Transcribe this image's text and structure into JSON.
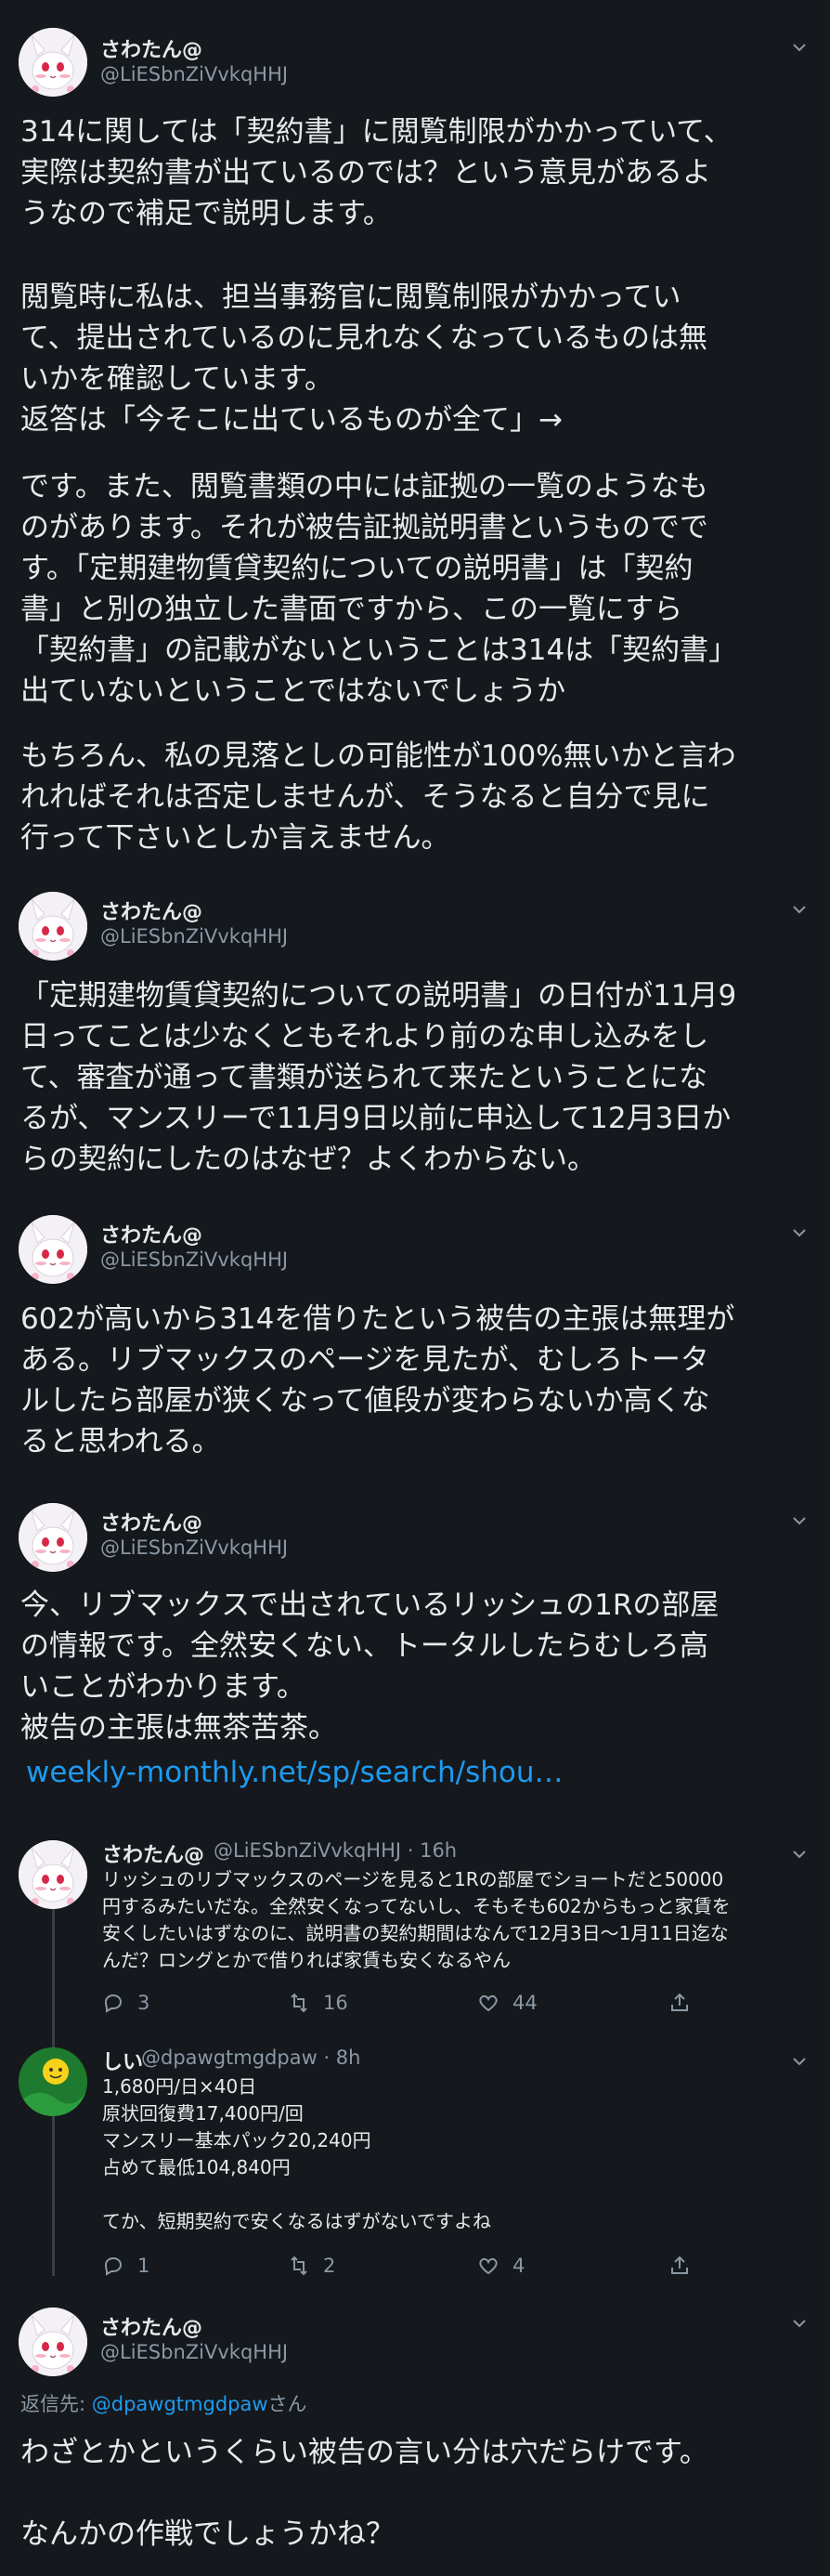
{
  "user": {
    "name": "さわたん@",
    "handle": "@LiESbnZiVvkqHHJ"
  },
  "tweets": [
    {
      "p1": "314に関しては「契約書」に閲覧制限がかかっていて、\n実際は契約書が出ているのでは？という意見があるよ\nうなので補足で説明します。",
      "p2": "閲覧時に私は、担当事務官に閲覧制限がかかってい\nて、提出されているのに見れなくなっているものは無\nいかを確認しています。\n返答は「今そこに出ているものが全て」→",
      "p3": "です。また、閲覧書類の中には証拠の一覧のようなも\nのがあります。それが被告証拠説明書というものでで\nす。「定期建物賃貸契約についての説明書」は「契約\n書」と別の独立した書面ですから、この一覧にすら\n「契約書」の記載がないということは314は「契約書」\n出ていないということではないでしょうか",
      "p4": "もちろん、私の見落としの可能性が100%無いかと言わ\nれればそれは否定しませんが、そうなると自分で見に\n行って下さいとしか言えません。"
    },
    {
      "text": "「定期建物賃貸契約についての説明書」の日付が11月9\n日ってことは少なくともそれより前のな申し込みをし\nて、審査が通って書類が送られて来たということにな\nるが、マンスリーで11月9日以前に申込して12月3日か\nらの契約にしたのはなぜ？よくわからない。"
    },
    {
      "text": "602が高いから314を借りたという被告の主張は無理が\nある。リブマックスのページを見たが、むしろトータ\nルしたら部屋が狭くなって値段が変わらないか高くな\nると思われる。"
    },
    {
      "text": "今、リブマックスで出されているリッシュの1Rの部屋\nの情報です。全然安くない、トータルしたらむしろ高\nいことがわかります。\n被告の主張は無茶苦茶。",
      "link": "weekly-monthly.net/sp/search/shou…"
    }
  ],
  "replies": [
    {
      "name": "さわたん@",
      "meta": "@LiESbnZiVvkqHHJ · 16h",
      "text": "リッシュのリブマックスのページを見ると1Rの部屋でショートだと50000\n円するみたいだな。全然安くなってないし、そもそも602からもっと家賃を\n安くしたいはずなのに、説明書の契約期間はなんで12月3日〜1月11日迄な\nんだ？ロングとかで借りれば家賃も安くなるやん",
      "replies": "3",
      "retweets": "16",
      "likes": "44"
    },
    {
      "name": "しい",
      "meta": "@dpawgtmgdpaw · 8h",
      "text": "1,680円/日×40日\n原状回復費17,400円/回\nマンスリー基本パック20,240円\n占めて最低104,840円\n\nてか、短期契約で安くなるはずがないですよね",
      "replies": "1",
      "retweets": "2",
      "likes": "4"
    }
  ],
  "final": {
    "reply_label": "返信先: ",
    "reply_mention": "@dpawgtmgdpaw",
    "reply_suffix": "さん",
    "text": "わざとかというくらい被告の言い分は穴だらけです。\n\nなんかの作戦でしょうかね？"
  }
}
